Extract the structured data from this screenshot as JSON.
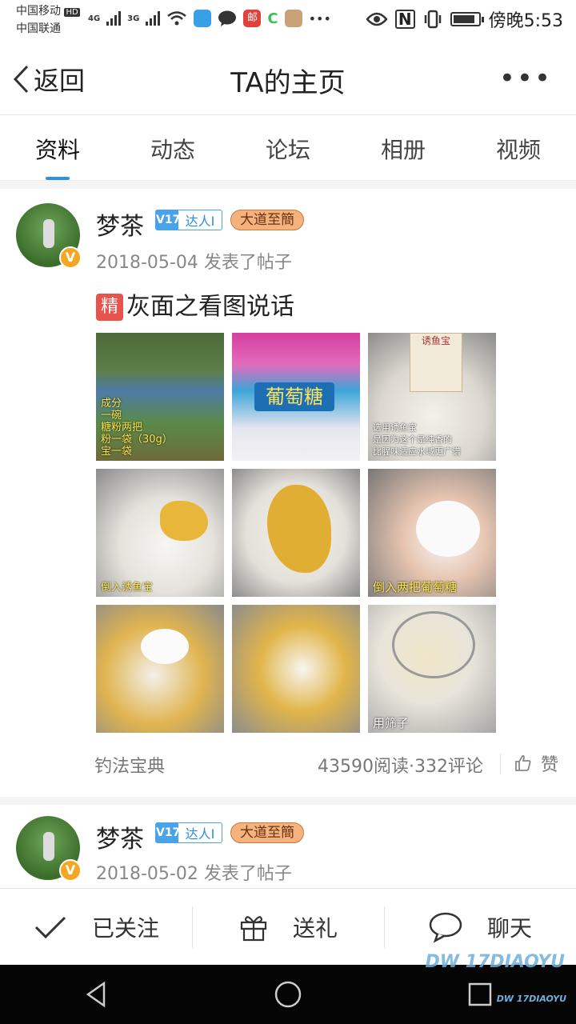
{
  "status_bar": {
    "carrier1": "中国移动",
    "carrier2": "中国联通",
    "hd": "HD",
    "net1": "4G",
    "net2": "3G",
    "time": "傍晚5:53",
    "nfc": "N",
    "battery_level": 0.85,
    "mail_app": "邮"
  },
  "header": {
    "back_label": "返回",
    "title": "TA的主页",
    "more": "•••"
  },
  "tabs": [
    {
      "label": "资料",
      "active": true
    },
    {
      "label": "动态",
      "active": false
    },
    {
      "label": "论坛",
      "active": false
    },
    {
      "label": "相册",
      "active": false
    },
    {
      "label": "视频",
      "active": false
    }
  ],
  "posts": [
    {
      "author": "梦茶",
      "v_badge": "V17",
      "level_badge": "达人I",
      "title_badge": "大道至簡",
      "meta": "2018-05-04 发表了帖子",
      "featured": "精",
      "title": "灰面之看图说话",
      "captions": {
        "p1": "成分\n一碗\n糖粉两把\n粉一袋（30g）\n宝一袋",
        "p2": "葡萄糖",
        "p3_bag": "诱鱼宝",
        "p3": "选用诱鱼宝\n是因为这个是纯香的\n比腥味适应水域更广谱",
        "p4": "倒入诱鱼宝",
        "p6": "倒入两把葡萄糖",
        "p9": "用筛子"
      },
      "source": "钓法宝典",
      "stats": "43590阅读·332评论",
      "like": "赞"
    },
    {
      "author": "梦茶",
      "v_badge": "V17",
      "level_badge": "达人I",
      "title_badge": "大道至簡",
      "meta": "2018-05-02 发表了帖子"
    }
  ],
  "actions": {
    "follow": "已关注",
    "gift": "送礼",
    "chat": "聊天"
  },
  "watermark": {
    "main": "DW 17DIAOYU",
    "small": "DW 17DIAOYU"
  },
  "colors": {
    "accent": "#2e91e8",
    "v_badge": "#4aa3e8",
    "featured": "#e8534b",
    "avatar_badge": "#f5a623"
  }
}
